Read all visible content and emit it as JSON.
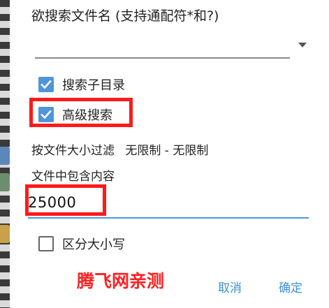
{
  "dialog": {
    "title": "欲搜索文件名 (支持通配符*和?)",
    "filename_input": {
      "value": "",
      "placeholder": ""
    },
    "search_subdirs": {
      "label": "搜索子目录",
      "checked": true
    },
    "advanced_search": {
      "label": "高级搜索",
      "checked": true
    },
    "size_filter": {
      "label": "按文件大小过滤",
      "value": "无限制 - 无限制"
    },
    "content_label": "文件中包含内容",
    "content_value": "25000",
    "case_sensitive": {
      "label": "区分大小写",
      "checked": false
    },
    "watermark": "腾飞网亲测",
    "buttons": {
      "cancel": "取消",
      "confirm": "确定"
    }
  },
  "colors": {
    "accent": "#4f95d9",
    "highlight_box": "#ff1a1a",
    "watermark": "#ff2020",
    "button_text": "#3d8fd6"
  },
  "icons": {
    "checked": "checkmark-icon",
    "dropdown": "dropdown-arrow-icon"
  }
}
